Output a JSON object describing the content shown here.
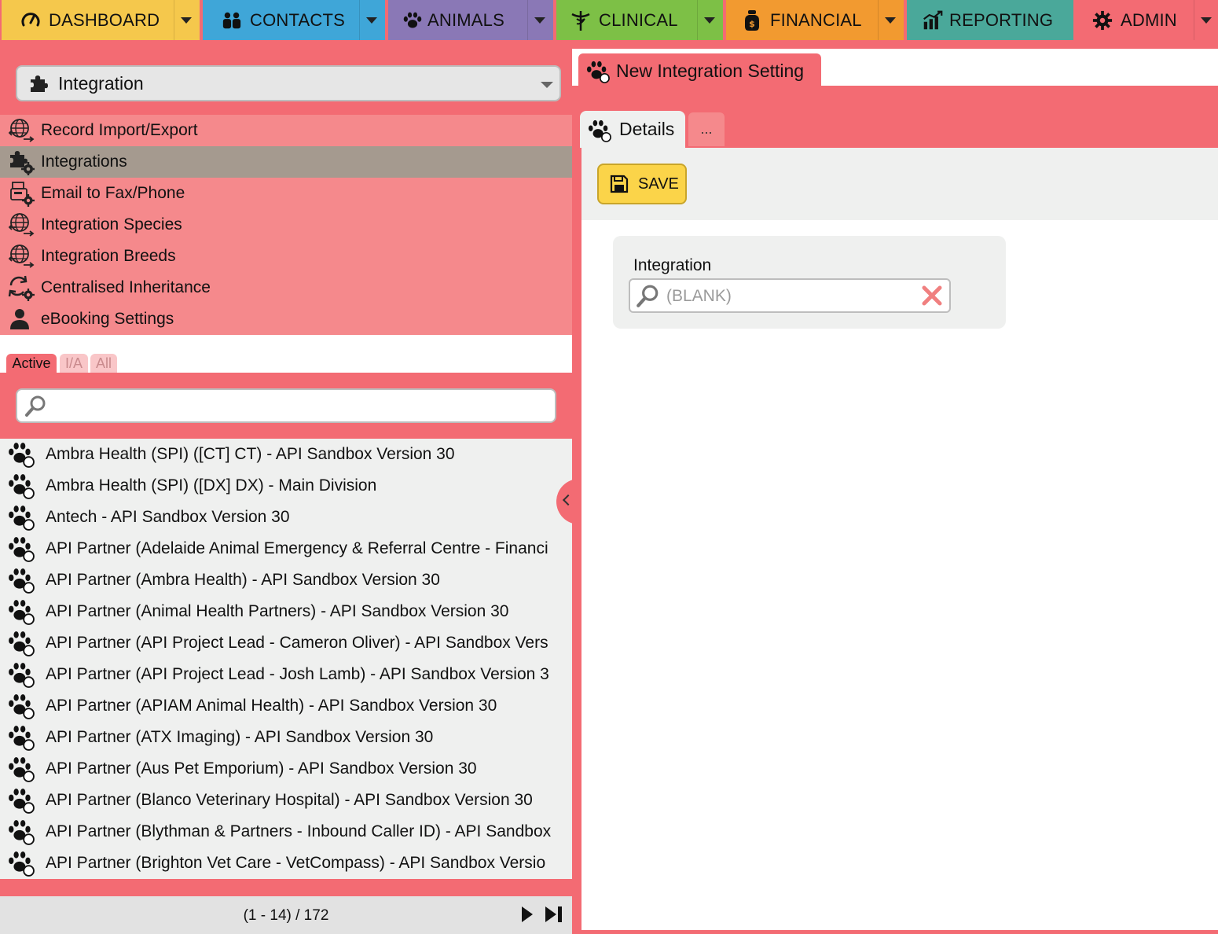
{
  "nav": {
    "tabs": [
      {
        "label": "DASHBOARD",
        "icon": "gauge-icon",
        "color": "#f5c84c"
      },
      {
        "label": "CONTACTS",
        "icon": "people-icon",
        "color": "#3fa6d8"
      },
      {
        "label": "ANIMALS",
        "icon": "paw-icon",
        "color": "#8a78b6"
      },
      {
        "label": "CLINICAL",
        "icon": "caduceus-icon",
        "color": "#7dc046"
      },
      {
        "label": "FINANCIAL",
        "icon": "money-bag-icon",
        "color": "#f29a30"
      },
      {
        "label": "REPORTING",
        "icon": "chart-icon",
        "color": "#4aa89a"
      },
      {
        "label": "ADMIN",
        "icon": "gear-icon",
        "color": "#f36b73"
      }
    ]
  },
  "sidebar": {
    "module_select": {
      "value": "Integration",
      "icon": "puzzle-icon"
    },
    "menu": [
      {
        "label": "Record Import/Export",
        "icon": "globe-arrows-icon",
        "active": false
      },
      {
        "label": "Integrations",
        "icon": "puzzle-gear-icon",
        "active": true
      },
      {
        "label": "Email to Fax/Phone",
        "icon": "fax-gear-icon",
        "active": false
      },
      {
        "label": "Integration Species",
        "icon": "globe-arrows-icon",
        "active": false
      },
      {
        "label": "Integration Breeds",
        "icon": "globe-arrows-icon",
        "active": false
      },
      {
        "label": "Centralised Inheritance",
        "icon": "refresh-gear-icon",
        "active": false
      },
      {
        "label": "eBooking Settings",
        "icon": "user-icon",
        "active": false
      }
    ],
    "filter_tabs": {
      "active": "Active",
      "inactive": "I/A",
      "all": "All"
    },
    "search": {
      "value": "",
      "placeholder": ""
    },
    "records": [
      "Ambra Health (SPI) ([CT] CT) - API Sandbox Version 30",
      "Ambra Health (SPI) ([DX] DX) - Main Division",
      "Antech - API Sandbox Version 30",
      "API Partner (Adelaide Animal Emergency & Referral Centre - Financi",
      "API Partner (Ambra Health) - API Sandbox Version 30",
      "API Partner (Animal Health Partners) - API Sandbox Version 30",
      "API Partner (API Project Lead - Cameron Oliver) - API Sandbox Vers",
      "API Partner (API Project Lead - Josh Lamb) - API Sandbox Version 3",
      "API Partner (APIAM Animal Health) - API Sandbox Version 30",
      "API Partner (ATX Imaging) - API Sandbox Version 30",
      "API Partner (Aus Pet Emporium) - API Sandbox Version 30",
      "API Partner (Blanco Veterinary Hospital) - API Sandbox Version 30",
      "API Partner (Blythman & Partners - Inbound Caller ID) - API Sandbox",
      "API Partner (Brighton Vet Care - VetCompass) - API Sandbox Versio"
    ],
    "pager": {
      "text": "(1 - 14) / 172"
    }
  },
  "main": {
    "tab_title": "New Integration Setting",
    "subtabs": {
      "details": "Details",
      "more": "..."
    },
    "save_label": "SAVE",
    "form": {
      "integration_label": "Integration",
      "integration_placeholder": "(BLANK)",
      "integration_value": ""
    }
  }
}
